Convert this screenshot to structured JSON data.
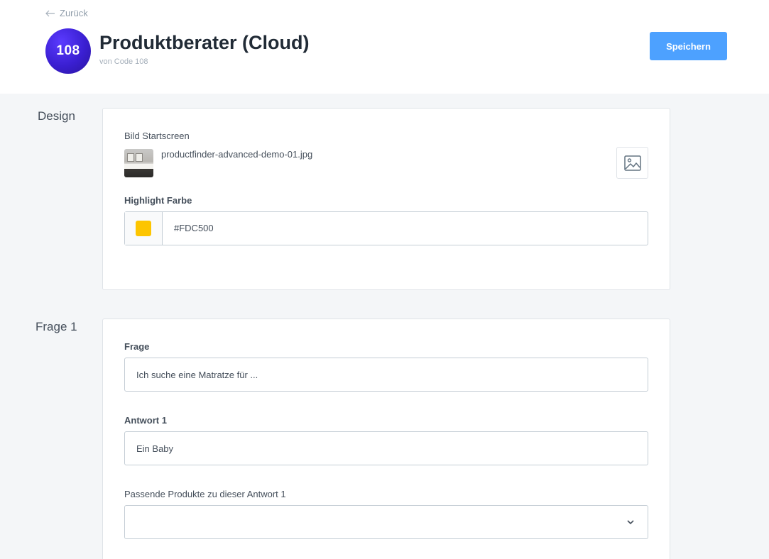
{
  "header": {
    "back_label": "Zurück",
    "logo_text": "108",
    "title": "Produktberater (Cloud)",
    "subtitle": "von Code 108",
    "save_label": "Speichern"
  },
  "design": {
    "section_label": "Design",
    "start_image_label": "Bild Startscreen",
    "start_image_filename": "productfinder-advanced-demo-01.jpg",
    "highlight_label": "Highlight Farbe",
    "highlight_value": "#FDC500"
  },
  "question1": {
    "section_label": "Frage 1",
    "question_label": "Frage",
    "question_value": "Ich suche eine Matratze für ...",
    "answer1_label": "Antwort 1",
    "answer1_value": "Ein Baby",
    "products_label": "Passende Produkte zu dieser Antwort 1",
    "products_value": ""
  },
  "colors": {
    "primary_button": "#4da1ff",
    "highlight": "#FDC500",
    "logo": "#3a1fd1"
  }
}
